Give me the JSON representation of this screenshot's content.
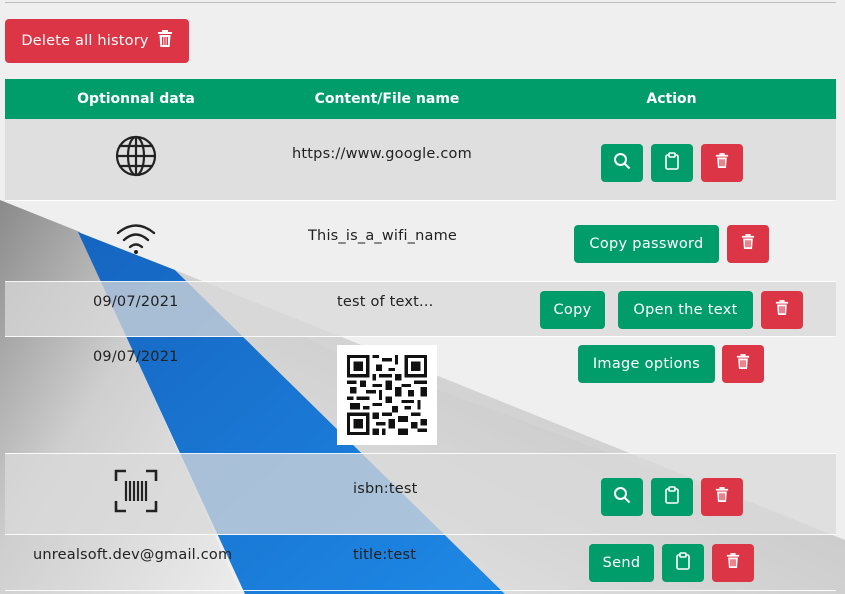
{
  "toolbar": {
    "delete_all_label": "Delete all history"
  },
  "table": {
    "headers": [
      "Optionnal data",
      "Content/File name",
      "Action"
    ],
    "rows": [
      {
        "optional": "",
        "optional_icon": "globe-icon",
        "content": "https://www.google.com",
        "actions": [
          "search-icon",
          "clipboard-icon",
          "trash-icon"
        ]
      },
      {
        "optional": "",
        "optional_icon": "wifi-icon",
        "content": "This_is_a_wifi_name",
        "actions": [
          "Copy password",
          "trash-icon"
        ]
      },
      {
        "optional": "09/07/2021",
        "content": "test of text...",
        "actions": [
          "Copy",
          "Open the text",
          "trash-icon"
        ]
      },
      {
        "optional": "09/07/2021",
        "content_icon": "qr-code-image",
        "actions": [
          "Image options",
          "trash-icon"
        ]
      },
      {
        "optional": "",
        "optional_icon": "barcode-scan-icon",
        "content": "isbn:test",
        "actions": [
          "search-icon",
          "clipboard-icon",
          "trash-icon"
        ]
      },
      {
        "optional": "unrealsoft.dev@gmail.com",
        "content": "title:test",
        "actions": [
          "Send",
          "clipboard-icon",
          "trash-icon"
        ]
      }
    ]
  },
  "colors": {
    "accent": "#009d6a",
    "danger": "#dc3545",
    "background_stripe": "#1a7fd4"
  }
}
